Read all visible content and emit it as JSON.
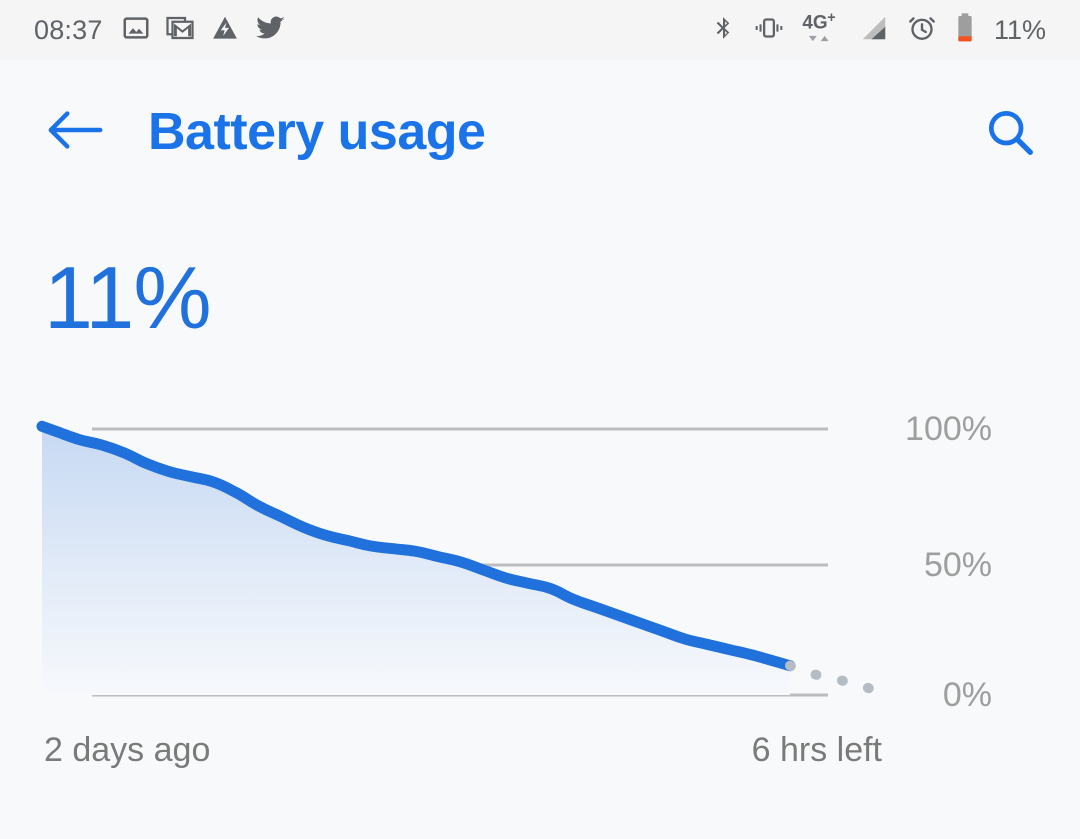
{
  "status_bar": {
    "time": "08:37",
    "battery_percent": "11%",
    "left_icons": [
      {
        "name": "photos-icon",
        "label": "Photos"
      },
      {
        "name": "gmail-icon",
        "label": "Gmail"
      },
      {
        "name": "android-auto-icon",
        "label": "Android Auto"
      },
      {
        "name": "twitter-icon",
        "label": "Twitter"
      }
    ],
    "right_icons": [
      {
        "name": "bluetooth-icon",
        "label": "Bluetooth"
      },
      {
        "name": "vibrate-icon",
        "label": "Vibrate"
      },
      {
        "name": "network-4g-plus-icon",
        "label": "4G+"
      },
      {
        "name": "signal-strength-icon",
        "label": "Signal"
      },
      {
        "name": "alarm-clock-icon",
        "label": "Alarm"
      },
      {
        "name": "battery-low-icon",
        "label": "Battery low"
      }
    ],
    "network_label": "4G",
    "network_superscript": "+"
  },
  "app_bar": {
    "title": "Battery usage",
    "back_icon": "arrow-left-icon",
    "search_icon": "search-icon"
  },
  "summary": {
    "battery_level": "11%"
  },
  "colors": {
    "accent_blue": "#1a73e8",
    "line_blue": "#2171dd",
    "fill_top": "#cbdcf4",
    "fill_bottom": "#f6f8fb",
    "gridline": "#bdbdbd",
    "axis_text": "#9e9e9e",
    "status_text": "#5f6368",
    "background": "#f8f9fa",
    "battery_low": "#f4511e"
  },
  "chart_data": {
    "type": "area",
    "title": "Battery usage",
    "xlabel": "",
    "ylabel": "",
    "ylim": [
      0,
      100
    ],
    "yticks": [
      0,
      50,
      100
    ],
    "ytick_labels": [
      "0%",
      "50%",
      "100%"
    ],
    "xtick_labels": [
      "2 days ago",
      "6 hrs left"
    ],
    "x_start_label": "2 days ago",
    "x_end_label": "6 hrs left",
    "grid": true,
    "legend": "none",
    "series": [
      {
        "name": "Battery level history",
        "style": "solid",
        "x": [
          0,
          2,
          5,
          8,
          11,
          14,
          17,
          20,
          23,
          26,
          29,
          32,
          35,
          38,
          41,
          44,
          47,
          50,
          53,
          56,
          59,
          62,
          65,
          68,
          71,
          74,
          77,
          80,
          83,
          86,
          89,
          92,
          95,
          100
        ],
        "values": [
          101,
          99,
          96,
          94,
          91,
          87,
          84,
          82,
          80,
          76,
          71,
          67,
          63,
          60,
          58,
          56,
          55,
          54,
          52,
          50,
          47,
          44,
          42,
          40,
          36,
          33,
          30,
          27,
          24,
          21,
          19,
          17,
          15,
          11
        ]
      },
      {
        "name": "Projected remaining",
        "style": "dotted",
        "x": [
          100,
          103,
          106,
          109,
          112
        ],
        "values": [
          11,
          8,
          6,
          4,
          1
        ]
      }
    ]
  }
}
